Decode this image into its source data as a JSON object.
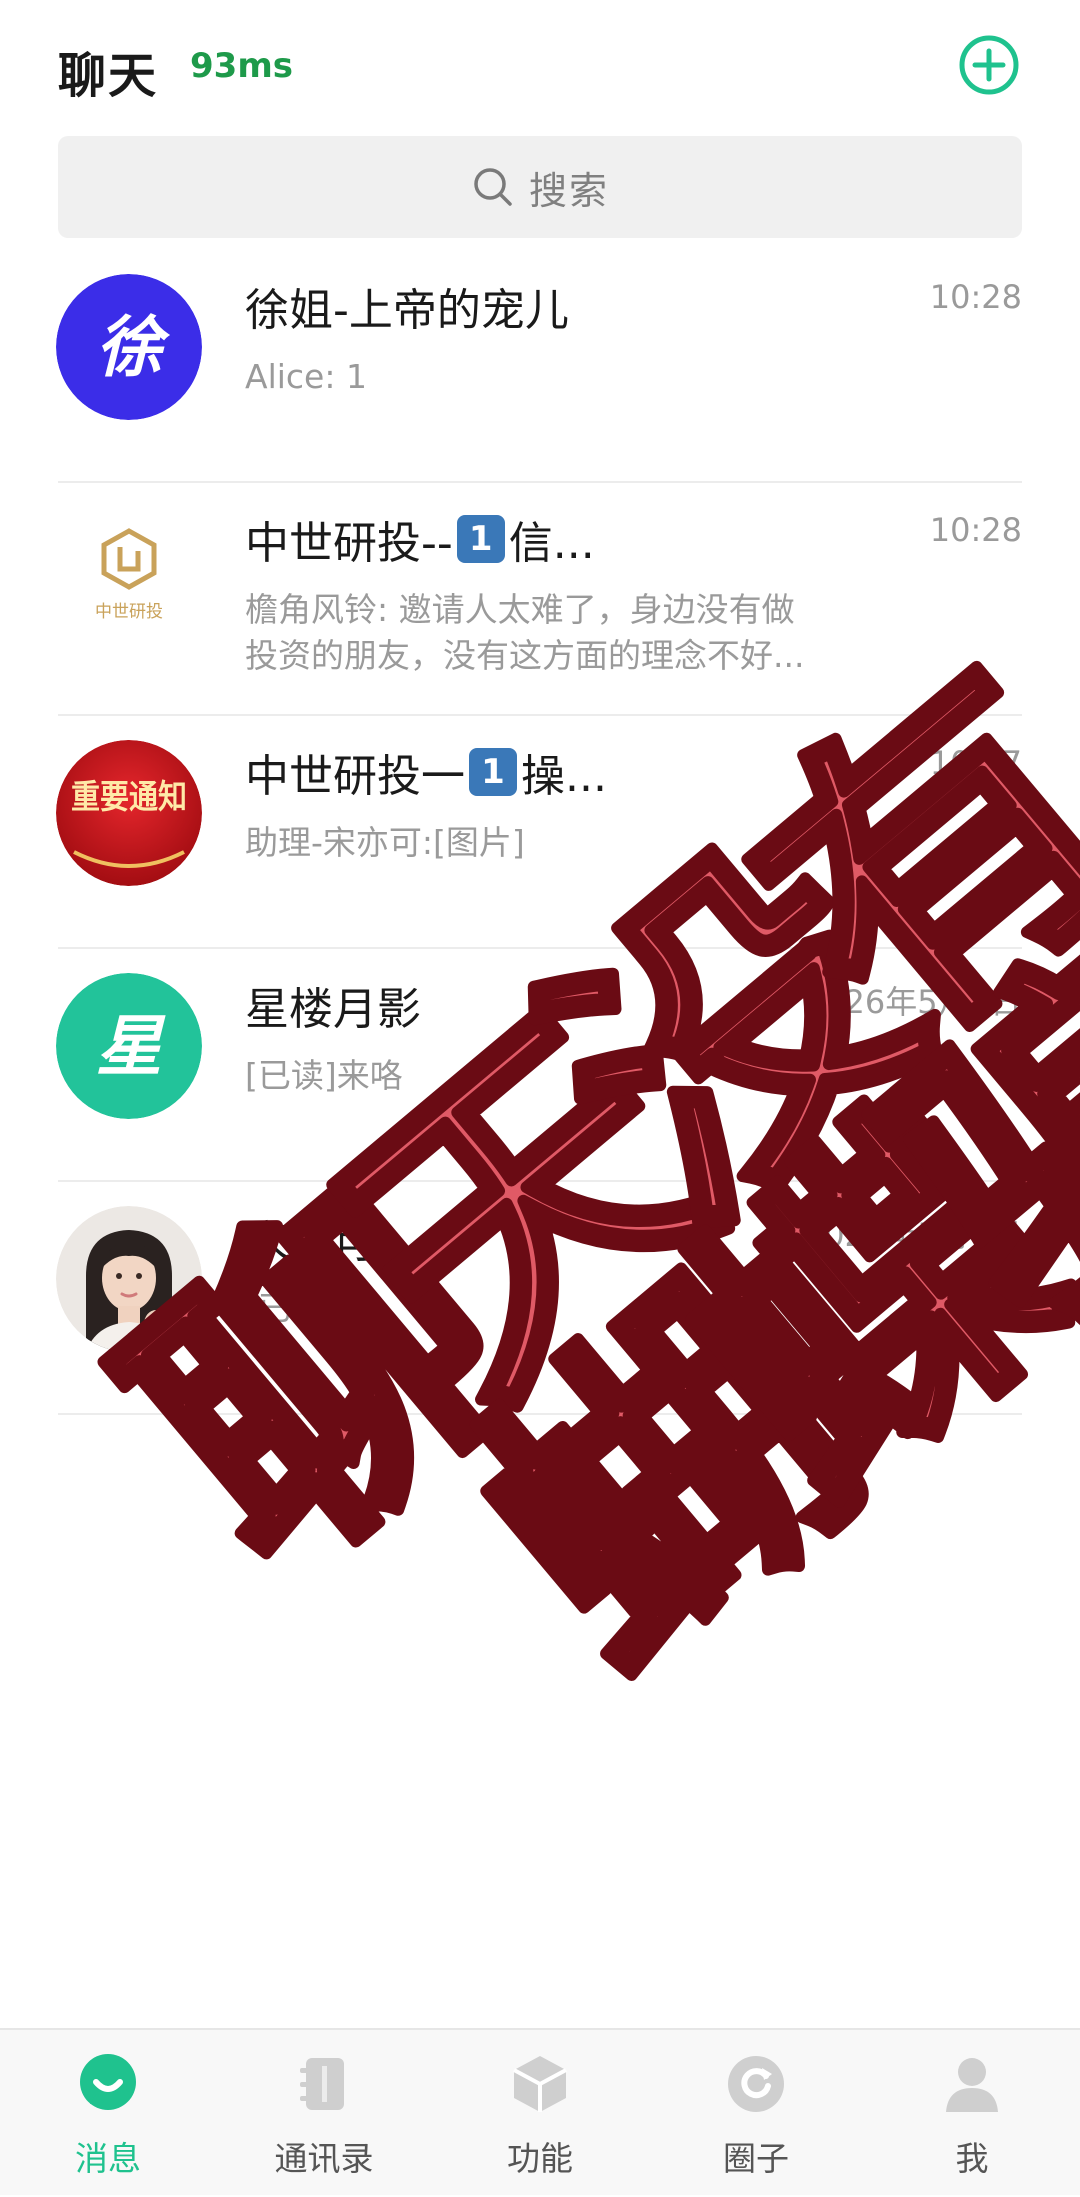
{
  "header": {
    "title": "聊天",
    "latency": "93ms",
    "add_icon": "plus-circle-icon",
    "accent_color": "#1fc28e"
  },
  "search": {
    "placeholder": "搜索",
    "icon": "search-icon"
  },
  "chats": [
    {
      "name": "徐姐-上帝的宠儿",
      "name_badge": "",
      "name_suffix": "",
      "avatar_text": "徐",
      "avatar_color": "#3b2de8",
      "time": "10:28",
      "preview_line1": "Alice: 1",
      "preview_line2": ""
    },
    {
      "name": "中世研投--",
      "name_badge": "1",
      "name_suffix": "信...",
      "avatar_text": "中世研投",
      "avatar_color": "#ffffff",
      "time": "10:28",
      "preview_line1": "檐角风铃: 邀请人太难了，身边没有做",
      "preview_line2": "投资的朋友，没有这方面的理念不好..."
    },
    {
      "name": "中世研投一",
      "name_badge": "1",
      "name_suffix": "操...",
      "avatar_text": "重要通知",
      "avatar_color": "#c8151b",
      "time": "10:07",
      "preview_line1": "助理-宋亦可:[图片]",
      "preview_line2": ""
    },
    {
      "name": "星楼月影",
      "name_badge": "",
      "name_suffix": "",
      "avatar_text": "星",
      "avatar_color": "#22c39a",
      "time": "2026年5月6日",
      "preview_line1": "[已读]来咯",
      "preview_line2": ""
    },
    {
      "name": "宋亦可",
      "name_badge": "",
      "name_suffix": "",
      "avatar_text": "",
      "avatar_color": "#e8e4e0",
      "time": "2026年5月6日",
      "preview_line1": "[已读]好",
      "preview_line2": ""
    }
  ],
  "watermark": {
    "chars": [
      "聊",
      "天",
      "没",
      "有",
      "蝴",
      "蝶",
      "骗",
      "局"
    ],
    "color": "#e05a66"
  },
  "nav": {
    "items": [
      {
        "label": "消息",
        "icon": "message-bubble-icon",
        "active": true
      },
      {
        "label": "通讯录",
        "icon": "contacts-icon",
        "active": false
      },
      {
        "label": "功能",
        "icon": "box-icon",
        "active": false
      },
      {
        "label": "圈子",
        "icon": "circle-refresh-icon",
        "active": false
      },
      {
        "label": "我",
        "icon": "user-icon",
        "active": false
      }
    ]
  }
}
